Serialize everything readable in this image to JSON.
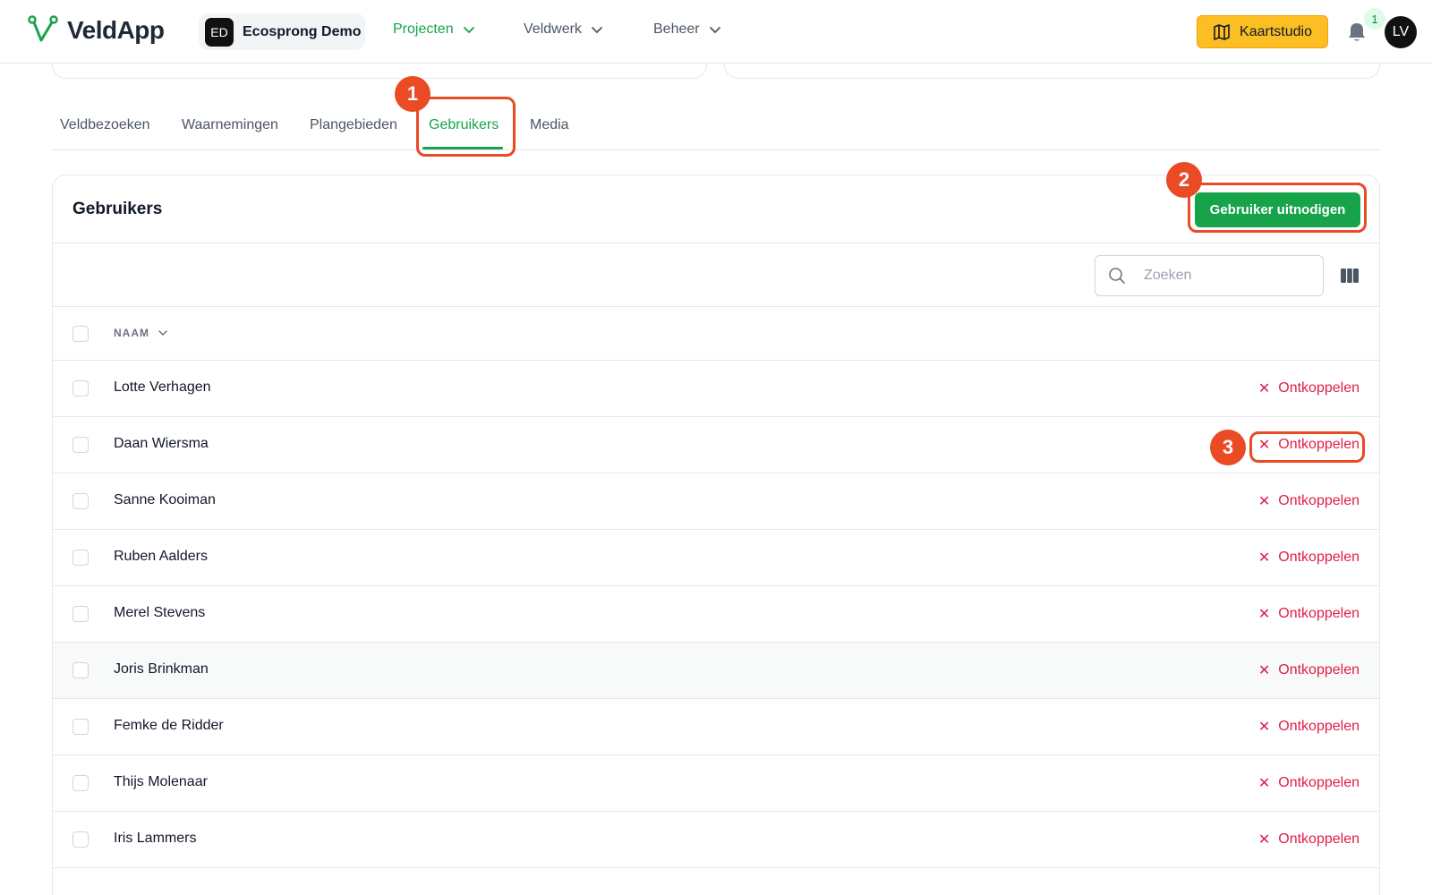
{
  "header": {
    "app_name": "VeldApp",
    "org": {
      "initials": "ED",
      "name": "Ecosprong Demo"
    },
    "nav": [
      {
        "label": "Projecten",
        "active": true
      },
      {
        "label": "Veldwerk",
        "active": false
      },
      {
        "label": "Beheer",
        "active": false
      }
    ],
    "kaartstudio_label": "Kaartstudio",
    "notification_count": "1",
    "avatar_initials": "LV"
  },
  "tabs": [
    {
      "label": "Veldbezoeken",
      "active": false
    },
    {
      "label": "Waarnemingen",
      "active": false
    },
    {
      "label": "Plangebieden",
      "active": false
    },
    {
      "label": "Gebruikers",
      "active": true
    },
    {
      "label": "Media",
      "active": false
    }
  ],
  "users_card": {
    "title": "Gebruikers",
    "invite_label": "Gebruiker uitnodigen",
    "search_placeholder": "Zoeken",
    "column_name": "NAAM",
    "unlink_label": "Ontkoppelen",
    "unlink_symbol": "✕",
    "rows": [
      {
        "name": "Lotte Verhagen"
      },
      {
        "name": "Daan Wiersma"
      },
      {
        "name": "Sanne Kooiman"
      },
      {
        "name": "Ruben Aalders"
      },
      {
        "name": "Merel Stevens"
      },
      {
        "name": "Joris Brinkman"
      },
      {
        "name": "Femke de Ridder"
      },
      {
        "name": "Thijs Molenaar"
      },
      {
        "name": "Iris Lammers"
      }
    ]
  },
  "annotations": [
    {
      "number": "1",
      "target": "Gebruikers tab"
    },
    {
      "number": "2",
      "target": "Gebruiker uitnodigen button"
    },
    {
      "number": "3",
      "target": "Ontkoppelen action"
    }
  ],
  "colors": {
    "accent_green": "#16a34a",
    "danger_red": "#e11d48",
    "annotation_orange": "#ea4a24",
    "kaartstudio_yellow": "#fbbf24"
  }
}
